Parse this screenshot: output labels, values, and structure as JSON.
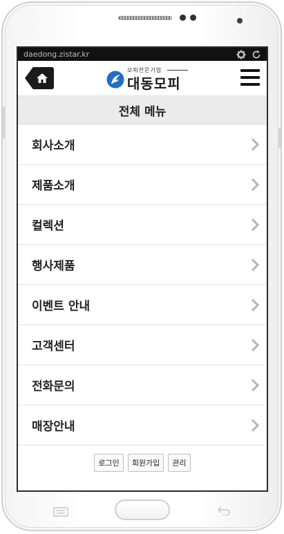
{
  "status_bar": {
    "url": "daedong.zistar.kr",
    "icons": [
      "gear-icon",
      "refresh-icon"
    ]
  },
  "header": {
    "home_icon": "home-icon",
    "logo_subtitle": "모피전문기업",
    "logo_name": "대동모피",
    "menu_icon": "hamburger-icon"
  },
  "page": {
    "title": "전체 메뉴"
  },
  "menu": {
    "items": [
      {
        "label": "회사소개"
      },
      {
        "label": "제품소개"
      },
      {
        "label": "컬렉션"
      },
      {
        "label": "행사제품"
      },
      {
        "label": "이벤트 안내"
      },
      {
        "label": "고객센터"
      },
      {
        "label": "전화문의"
      },
      {
        "label": "매장안내"
      }
    ]
  },
  "footer": {
    "login": "로그인",
    "signup": "회원가입",
    "admin": "관리"
  },
  "device": {
    "nav_icons": [
      "menu-key-icon",
      "home-key",
      "back-key-icon"
    ]
  },
  "colors": {
    "header_bar": "#ebebeb",
    "home_button": "#1b1b1b",
    "chevron": "#b4b4b4"
  }
}
